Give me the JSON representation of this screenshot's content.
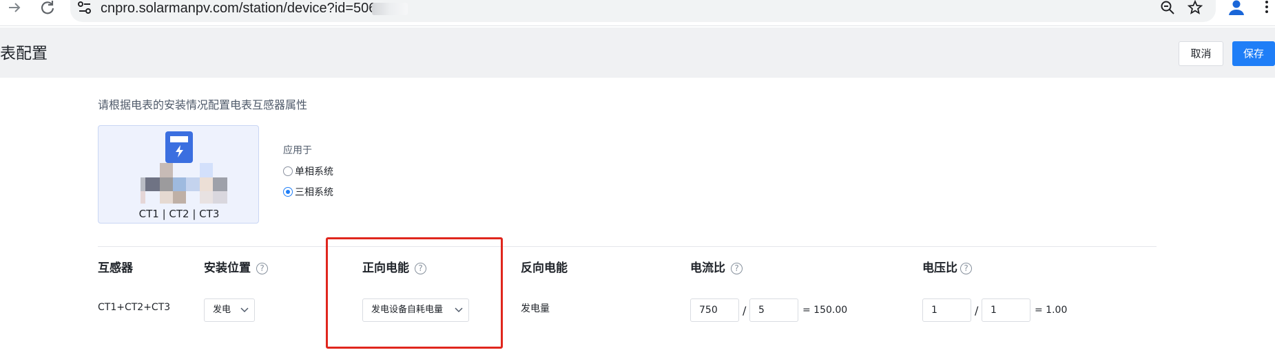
{
  "browser": {
    "url": "cnpro.solarmanpv.com/station/device?id=506"
  },
  "header": {
    "title": "表配置",
    "cancel_label": "取消",
    "save_label": "保存"
  },
  "config": {
    "hint": "请根据电表的安装情况配置电表互感器属性",
    "ct_label": "CT1 | CT2 | CT3",
    "apply_label": "应用于",
    "options": [
      "单相系统",
      "三相系统"
    ],
    "selected_option": "三相系统"
  },
  "table": {
    "headers": {
      "ct": "互感器",
      "position": "安装位置",
      "forward": "正向电能",
      "reverse": "反向电能",
      "current_ratio": "电流比",
      "voltage_ratio": "电压比"
    },
    "row": {
      "ct": "CT1+CT2+CT3",
      "position": "发电",
      "forward": "发电设备自耗电量",
      "reverse": "发电量",
      "current_primary": "750",
      "current_secondary": "5",
      "current_result": "= 150.00",
      "voltage_primary": "1",
      "voltage_secondary": "1",
      "voltage_result": "= 1.00"
    }
  },
  "colors": {
    "accent": "#1f7ef7",
    "highlight": "#e0261d",
    "header_band": "#f0f1f3"
  }
}
